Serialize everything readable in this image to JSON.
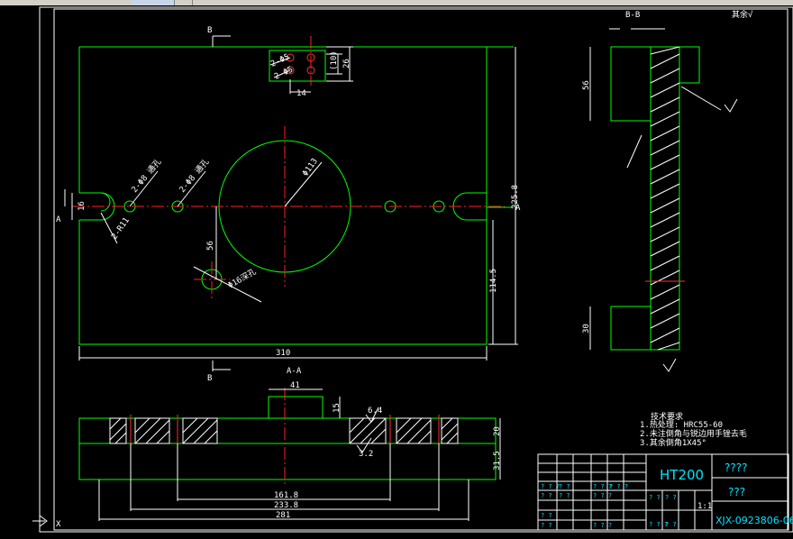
{
  "window": {
    "toolbar_label": ""
  },
  "labels": {
    "section_bb": "B-B",
    "section_aa": "A-A",
    "surface_rest": "其余√",
    "cut_b_top": "B",
    "cut_b_bottom": "B",
    "cut_a_left": "A",
    "cut_a_right": "A",
    "x_axis": "X"
  },
  "dims": {
    "d310": "310",
    "d281": "281",
    "d233_8": "233.8",
    "d161_8": "161.8",
    "d31_5": "31.5",
    "d20": "20",
    "d15": "15",
    "d41": "41",
    "d56_front": "56",
    "d114_5": "114.5",
    "d225": "225.8",
    "d26": "26",
    "d14": "14",
    "d10": "10",
    "d30_box": "(10)",
    "d56_side": "56",
    "d30_side": "30",
    "d16": "16",
    "d_big": "Φ113",
    "d_holes1": "2-Φ8 通孔",
    "d_holes2": "2-Φ8 通孔",
    "d_r": "2-R11",
    "d_hole_bottom": "Φ16深孔",
    "d_small1": "2-Φ5",
    "d_small2": "2-Φ5",
    "d_roughness": "6.4",
    "d_roughness2": "3.2"
  },
  "notes": {
    "title": "技术要求",
    "line1": "1.热处理: HRC55-60",
    "line2": "2.未注倒角与锐边用手锉去毛",
    "line3": "3.其余倒角1X45°"
  },
  "title_block": {
    "material": "HT200",
    "name_q1": "????",
    "name_q2": "???",
    "drawing_no": "XJX-0923806-06",
    "scale": "1:1",
    "cells": [
      "? ? ?",
      "? ?",
      "? ? ?",
      "? ? ?",
      "? ?",
      "? ?",
      "? ? ?",
      "? ?",
      "? ?",
      "? ?",
      "? ?",
      "? ? ?",
      "? ? ?",
      "? ?"
    ]
  }
}
